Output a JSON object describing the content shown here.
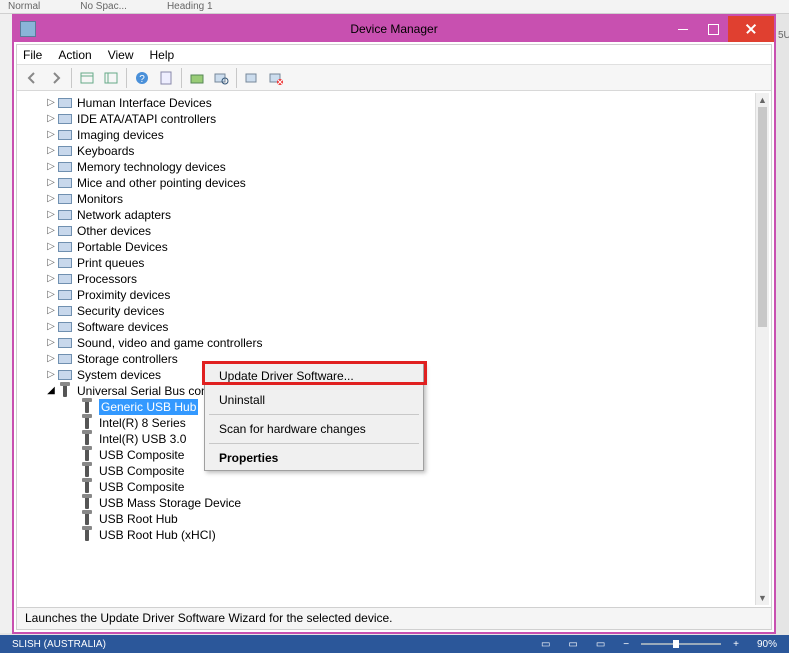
{
  "bg": {
    "normal": "Normal",
    "nospac": "No Spac...",
    "heading": "Heading 1"
  },
  "window": {
    "title": "Device Manager",
    "menus": [
      "File",
      "Action",
      "View",
      "Help"
    ],
    "statusbar": "Launches the Update Driver Software Wizard for the selected device."
  },
  "toolbar_icons": [
    "back-icon",
    "forward-icon",
    "show-hidden-icon",
    "properties-icon",
    "help-icon",
    "update-icon",
    "scan-icon",
    "uninstall-icon",
    "disable-icon"
  ],
  "tree": {
    "collapsed": [
      "Human Interface Devices",
      "IDE ATA/ATAPI controllers",
      "Imaging devices",
      "Keyboards",
      "Memory technology devices",
      "Mice and other pointing devices",
      "Monitors",
      "Network adapters",
      "Other devices",
      "Portable Devices",
      "Print queues",
      "Processors",
      "Proximity devices",
      "Security devices",
      "Software devices",
      "Sound, video and game controllers",
      "Storage controllers",
      "System devices"
    ],
    "expanded": {
      "label": "Universal Serial Bus controllers",
      "children": [
        "Generic USB Hub",
        "Intel(R) 8 Series",
        "Intel(R) USB 3.0",
        "USB Composite",
        "USB Composite",
        "USB Composite",
        "USB Mass Storage Device",
        "USB Root Hub",
        "USB Root Hub (xHCI)"
      ],
      "selected_index": 0
    }
  },
  "context_menu": {
    "items": [
      {
        "label": "Update Driver Software...",
        "highlight": true
      },
      {
        "label": "Uninstall"
      },
      {
        "sep": true
      },
      {
        "label": "Scan for hardware changes"
      },
      {
        "sep": true
      },
      {
        "label": "Properties",
        "bold": true
      }
    ]
  },
  "taskbar": {
    "lang": "SLISH (AUSTRALIA)",
    "zoom_minus": "−",
    "zoom_plus": "+",
    "zoom_pct": "90%"
  },
  "right_label": "5U"
}
